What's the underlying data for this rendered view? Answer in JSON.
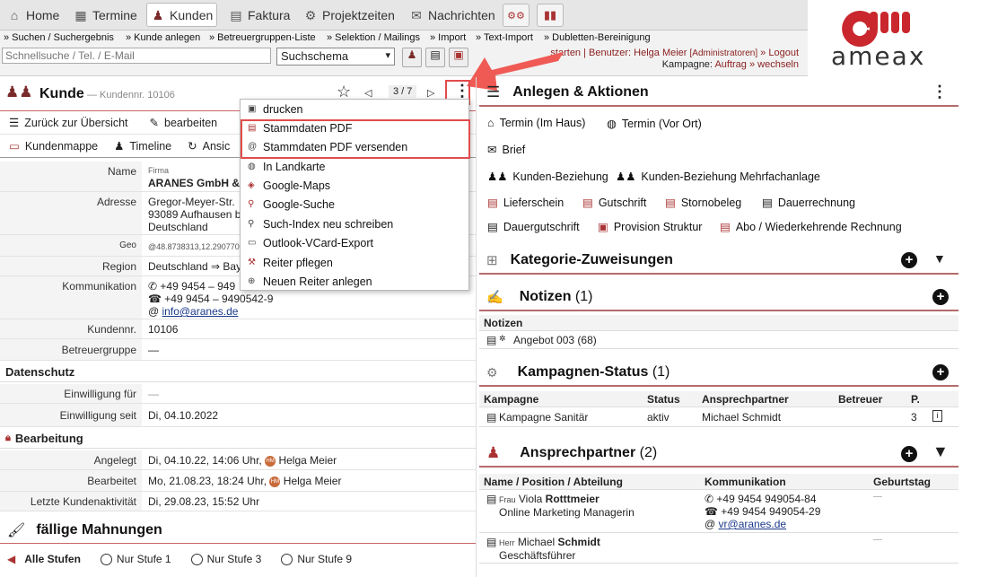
{
  "nav": {
    "tabs": [
      {
        "label": "Home",
        "icon": "home-icon"
      },
      {
        "label": "Termine",
        "icon": "calendar-icon"
      },
      {
        "label": "Kunden",
        "icon": "users-icon",
        "active": true
      },
      {
        "label": "Faktura",
        "icon": "document-icon"
      },
      {
        "label": "Projektzeiten",
        "icon": "gear-icon"
      },
      {
        "label": "Nachrichten",
        "icon": "envelope-icon"
      }
    ]
  },
  "subnav": [
    "» Suchen / Suchergebnis",
    "» Kunde anlegen",
    "» Betreuergruppen-Liste",
    "» Selektion / Mailings",
    "» Import",
    "» Text-Import",
    "» Dubletten-Bereinigung"
  ],
  "search": {
    "placeholder": "Schnellsuche / Tel. / E-Mail",
    "schema": "Suchschema"
  },
  "userinfo": {
    "line1_a": "starten | Benutzer: Helga Meier ",
    "admin": "[Administratoren]",
    "line1_b": " » Logout",
    "line2_a": "Kampagne: ",
    "campaign": "Auftrag",
    "line2_b": " » wechseln"
  },
  "logo": {
    "text": "ameax"
  },
  "customer": {
    "title": "Kunde",
    "nr_label": "— Kundennr. 10106",
    "pager": "3 / 7"
  },
  "toolbar": {
    "back": "Zurück zur Übersicht",
    "edit": "bearbeiten",
    "folder": "Kundenmappe",
    "timeline": "Timeline",
    "view": "Ansic"
  },
  "fields": {
    "name_label": "Name",
    "firm_small": "Firma",
    "firm": "ARANES GmbH &",
    "addr_label": "Adresse",
    "addr1": "Gregor-Meyer-Str.",
    "addr2": "93089 Aufhausen b",
    "addr3": "Deutschland",
    "geo_label": "Geo",
    "geo": "@48.8738313,12.290770",
    "region_label": "Region",
    "region": "Deutschland ⇒ Bay",
    "comm_label": "Kommunikation",
    "tel": "+49 9454 – 949",
    "fax": "+49 9454 – 9490542-9",
    "mail": "info@aranes.de",
    "nr_label": "Kundennr.",
    "nr": "10106",
    "betreuer_label": "Betreuergruppe",
    "betreuer": "—"
  },
  "datenschutz": {
    "title": "Datenschutz",
    "consent_for_label": "Einwilligung für",
    "consent_for": "—",
    "consent_since_label": "Einwilligung seit",
    "consent_since": "Di, 04.10.2022"
  },
  "bearbeitung": {
    "title": "Bearbeitung",
    "created_label": "Angelegt",
    "created": "Di, 04.10.22, 14:06 Uhr,",
    "created_user": "Helga Meier",
    "edited_label": "Bearbeitet",
    "edited": "Mo, 21.08.23, 18:24 Uhr,",
    "edited_user": "Helga Meier",
    "last_label": "Letzte Kundenaktivität",
    "last": "Di, 29.08.23, 15:52 Uhr",
    "avatar": "HM"
  },
  "mahnungen": {
    "title": "fällige Mahnungen",
    "all": "Alle Stufen",
    "s1": "Nur Stufe 1",
    "s3": "Nur Stufe 3",
    "s9": "Nur Stufe 9"
  },
  "menu": [
    "drucken",
    "Stammdaten PDF",
    "Stammdaten PDF versenden",
    "In Landkarte",
    "Google-Maps",
    "Google-Suche",
    "Such-Index neu schreiben",
    "Outlook-VCard-Export",
    "Reiter pflegen",
    "Neuen Reiter anlegen"
  ],
  "actions": {
    "title": "Anlegen & Aktionen",
    "items": [
      "Termin (Im Haus)",
      "Termin (Vor Ort)",
      "Brief",
      "Kunden-Beziehung",
      "Kunden-Beziehung Mehrfachanlage",
      "Lieferschein",
      "Gutschrift",
      "Stornobeleg",
      "Dauerrechnung",
      "Dauergutschrift",
      "Provision Struktur",
      "Abo / Wiederkehrende Rechnung"
    ]
  },
  "kategorie": {
    "title": "Kategorie-Zuweisungen"
  },
  "notizen": {
    "title": "Notizen",
    "count": "(1)",
    "col": "Notizen",
    "row": "Angebot 003 (68)"
  },
  "kampagnen": {
    "title": "Kampagnen-Status",
    "count": "(1)",
    "cols": [
      "Kampagne",
      "Status",
      "Ansprechpartner",
      "Betreuer",
      "P."
    ],
    "row": [
      "Kampagne Sanitär",
      "aktiv",
      "Michael Schmidt",
      "",
      "3"
    ]
  },
  "ansprech": {
    "title": "Ansprechpartner",
    "count": "(2)",
    "cols": [
      "Name / Position / Abteilung",
      "Kommunikation",
      "Geburtstag"
    ],
    "p1_sal": "Frau",
    "p1_first": "Viola ",
    "p1_last": "Rotttmeier",
    "p1_pos": "Online Marketing Managerin",
    "p1_tel": "+49 9454 949054-84",
    "p1_fax": "+49 9454 949054-29",
    "p1_mail": "vr@aranes.de",
    "p1_bday": "—",
    "p2_sal": "Herr",
    "p2_first": "Michael ",
    "p2_last": "Schmidt",
    "p2_pos": "Geschäftsführer",
    "p2_bday": "—"
  }
}
